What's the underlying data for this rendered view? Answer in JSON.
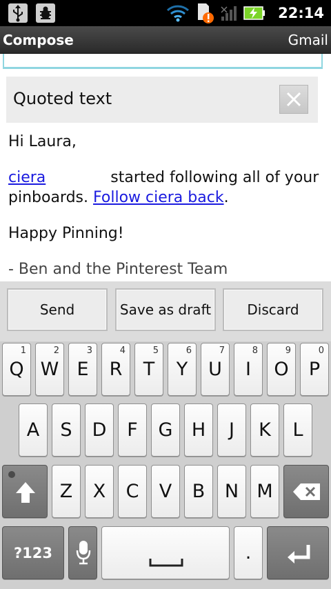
{
  "status_bar": {
    "time": "22:14",
    "icons": [
      "usb-icon",
      "debug-bug-icon",
      "wifi-icon",
      "sd-card-alert-icon",
      "signal-icon",
      "battery-charging-icon"
    ]
  },
  "app_bar": {
    "title": "Compose",
    "account": "Gmail"
  },
  "quoted": {
    "label": "Quoted text",
    "remove_icon": "close-icon"
  },
  "message": {
    "greeting": "Hi Laura,",
    "line1_link": "ciera",
    "line1_text": "started following all of your",
    "line2_text": "pinboards.",
    "line2_link": "Follow ciera back",
    "line2_end": ".",
    "happy": "Happy Pinning!",
    "signoff": "- Ben and the Pinterest Team"
  },
  "actions": {
    "send": "Send",
    "save_draft": "Save as draft",
    "discard": "Discard"
  },
  "keyboard": {
    "row1": [
      "Q",
      "W",
      "E",
      "R",
      "T",
      "Y",
      "U",
      "I",
      "O",
      "P"
    ],
    "row1_digits": [
      "1",
      "2",
      "3",
      "4",
      "5",
      "6",
      "7",
      "8",
      "9",
      "0"
    ],
    "row2": [
      "A",
      "S",
      "D",
      "F",
      "G",
      "H",
      "J",
      "K",
      "L"
    ],
    "row3": [
      "Z",
      "X",
      "C",
      "V",
      "B",
      "N",
      "M"
    ],
    "symbols": "?123",
    "period": "."
  },
  "colors": {
    "link": "#1a1adf",
    "focus_edge": "#8fd6e0",
    "battery": "#7bd428",
    "alert": "#ff6a00"
  }
}
